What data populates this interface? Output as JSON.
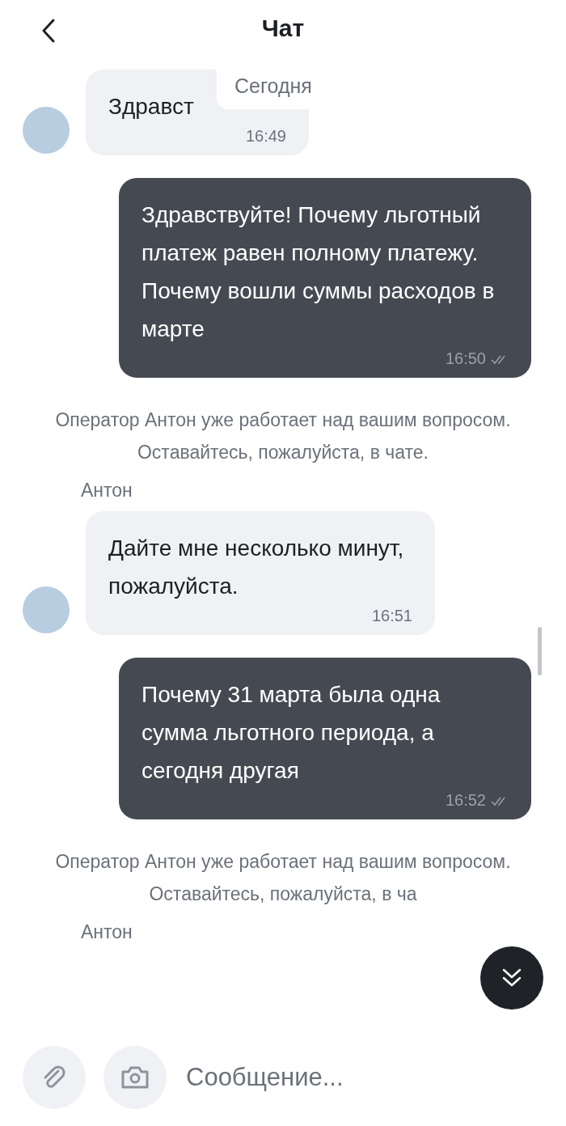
{
  "header": {
    "title": "Чат"
  },
  "date_chip": "Сегодня",
  "messages": [
    {
      "kind": "incoming",
      "text": "Здравст",
      "time": "16:49",
      "avatar": true
    },
    {
      "kind": "outgoing",
      "text": "Здравствуйте! Почему льготный платеж равен полному платежу. Почему вошли суммы расходов в марте",
      "time": "16:50",
      "read": true
    },
    {
      "kind": "system",
      "text": "Оператор Антон уже работает над вашим вопросом. Оставайтесь, пожалуйста, в чате."
    },
    {
      "kind": "sender",
      "text": "Антон"
    },
    {
      "kind": "incoming",
      "text": "Дайте мне несколько минут, пожалуйста.",
      "time": "16:51",
      "avatar": true
    },
    {
      "kind": "outgoing",
      "text": "Почему 31 марта была одна сумма льготного периода, а сегодня другая",
      "time": "16:52",
      "read": true
    },
    {
      "kind": "system",
      "text": "Оператор Антон уже работает над вашим вопросом. Оставайтесь, пожалуйста, в ча"
    },
    {
      "kind": "sender",
      "text": "Антон"
    }
  ],
  "composer": {
    "placeholder": "Сообщение..."
  }
}
